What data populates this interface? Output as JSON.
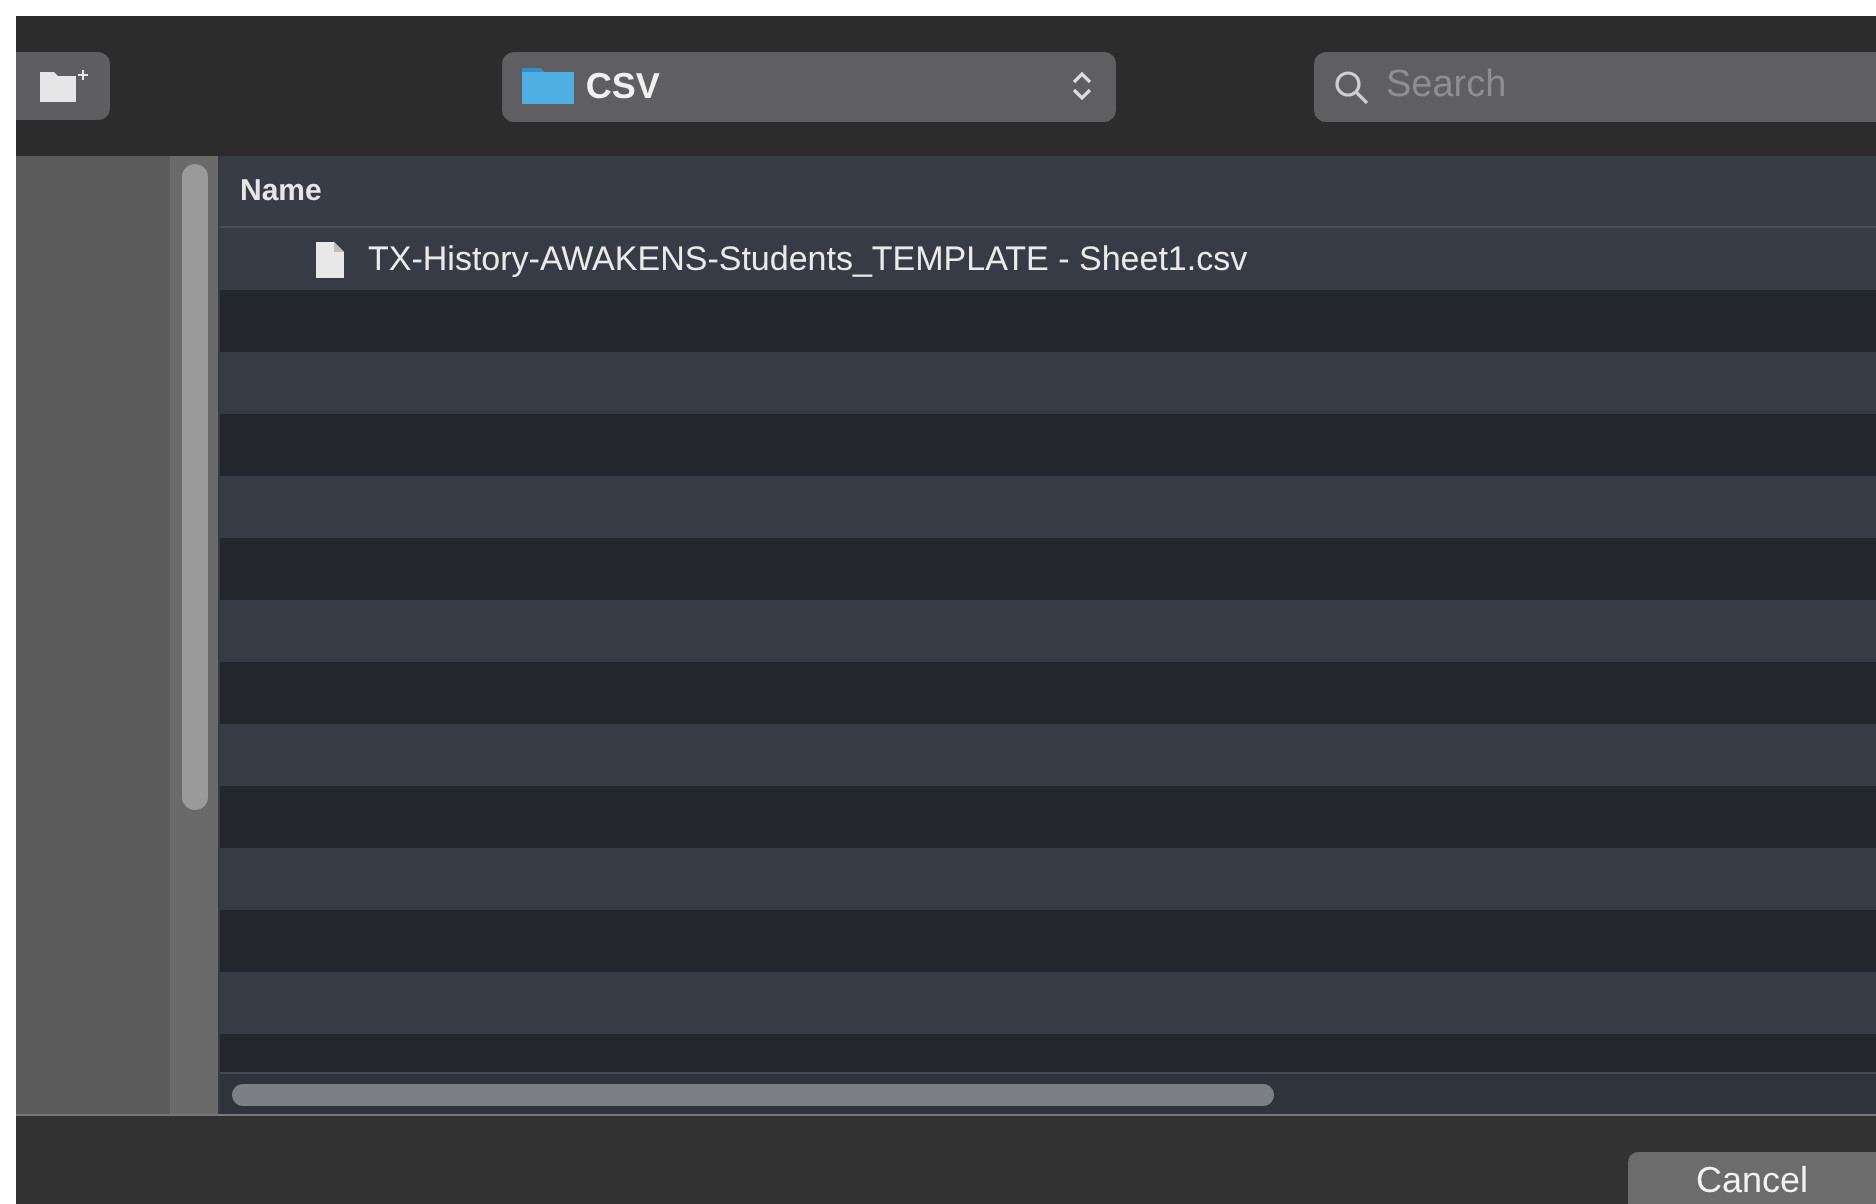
{
  "toolbar": {
    "location": "CSV",
    "search": {
      "placeholder": "Search"
    }
  },
  "table": {
    "columns": [
      "Name"
    ],
    "rows": [
      {
        "name": "TX-History-AWAKENS-Students_TEMPLATE - Sheet1.csv",
        "selected": false
      }
    ]
  },
  "buttons": [
    "Cancel"
  ]
}
